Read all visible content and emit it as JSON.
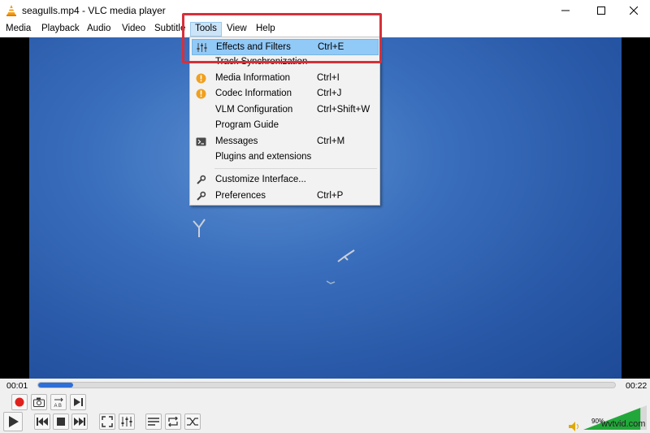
{
  "window": {
    "title": "seagulls.mp4 - VLC media player",
    "icon": "vlc-cone-icon",
    "buttons": [
      "minimize-icon",
      "maximize-icon",
      "close-icon"
    ]
  },
  "menubar": {
    "items": [
      "Media",
      "Playback",
      "Audio",
      "Video",
      "Subtitle",
      "Tools",
      "View",
      "Help"
    ],
    "active": "Tools"
  },
  "tools_menu": {
    "items": [
      {
        "label": "Effects and Filters",
        "shortcut": "Ctrl+E",
        "icon": "equalizer-icon",
        "highlighted": true
      },
      {
        "label": "Track Synchronization",
        "shortcut": "",
        "icon": ""
      },
      {
        "label": "Media Information",
        "shortcut": "Ctrl+I",
        "icon": "info-icon"
      },
      {
        "label": "Codec Information",
        "shortcut": "Ctrl+J",
        "icon": "info-icon"
      },
      {
        "label": "VLM Configuration",
        "shortcut": "Ctrl+Shift+W",
        "icon": ""
      },
      {
        "label": "Program Guide",
        "shortcut": "",
        "icon": ""
      },
      {
        "label": "Messages",
        "shortcut": "Ctrl+M",
        "icon": "terminal-icon"
      },
      {
        "label": "Plugins and extensions",
        "shortcut": "",
        "icon": ""
      },
      {
        "label": "Customize Interface...",
        "shortcut": "",
        "icon": "wrench-icon"
      },
      {
        "label": "Preferences",
        "shortcut": "Ctrl+P",
        "icon": "wrench-icon"
      }
    ]
  },
  "playback": {
    "elapsed": "00:01",
    "total": "00:22",
    "progress": 0.06
  },
  "volume": {
    "percent_label": "90%",
    "level": 0.9
  },
  "watermark": "wvtvid.com",
  "colors": {
    "accent": "#2e6fd8",
    "highlight_box": "#d6303a",
    "menu_highlight": "#91c9f7",
    "record": "#e0201c",
    "info_icon": "#f0a020",
    "volume": "#22a83a"
  }
}
